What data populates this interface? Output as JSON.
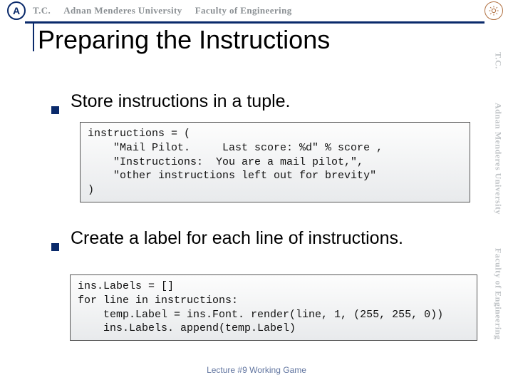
{
  "header": {
    "tc": "T.C.",
    "university": "Adnan Menderes University",
    "faculty": "Faculty of Engineering",
    "left_logo_letter": "A"
  },
  "title": "Preparing the Instructions",
  "bullets": [
    "Store instructions in a tuple.",
    "Create a label for each line of instructions."
  ],
  "code1": "instructions = (\n    \"Mail Pilot.     Last score: %d\" % score ,\n    \"Instructions:  You are a mail pilot,\",\n    \"other instructions left out for brevity\"\n)",
  "code2": "ins.Labels = []\nfor line in instructions:\n    temp.Label = ins.Font. render(line, 1, (255, 255, 0))\n    ins.Labels. append(temp.Label)",
  "side_rail": {
    "a": "T.C.",
    "b": "Adnan Menderes University",
    "c": "Faculty of Engineering"
  },
  "footer": "Lecture #9 Working Game"
}
